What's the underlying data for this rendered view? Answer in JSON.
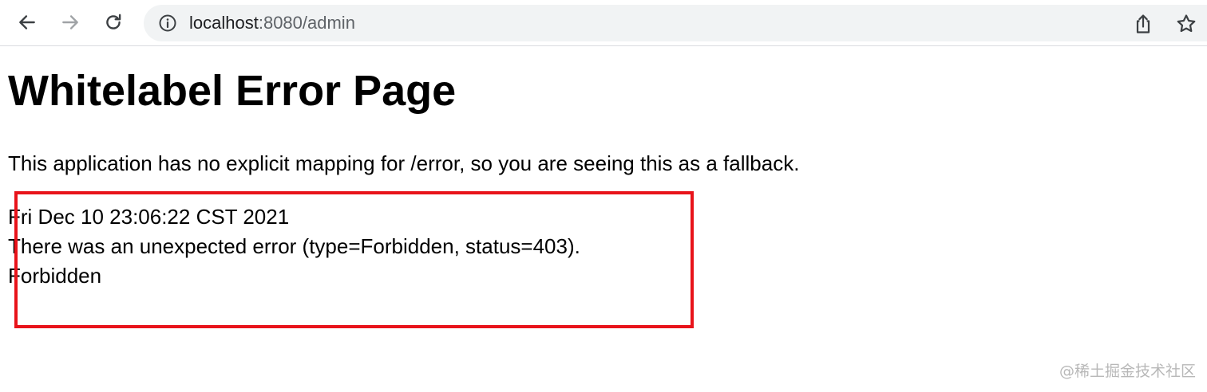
{
  "browser": {
    "url_host": "localhost",
    "url_rest": ":8080/admin",
    "icons": {
      "back": "arrow-left-icon",
      "forward": "arrow-right-icon",
      "reload": "reload-icon",
      "site_info": "info-icon",
      "share": "share-icon",
      "bookmark": "star-icon"
    }
  },
  "page": {
    "title": "Whitelabel Error Page",
    "description": "This application has no explicit mapping for /error, so you are seeing this as a fallback.",
    "error": {
      "timestamp": "Fri Dec 10 23:06:22 CST 2021",
      "message": "There was an unexpected error (type=Forbidden, status=403).",
      "detail": "Forbidden"
    }
  },
  "annotation": {
    "color": "#e8131a"
  },
  "watermark": "@稀土掘金技术社区"
}
